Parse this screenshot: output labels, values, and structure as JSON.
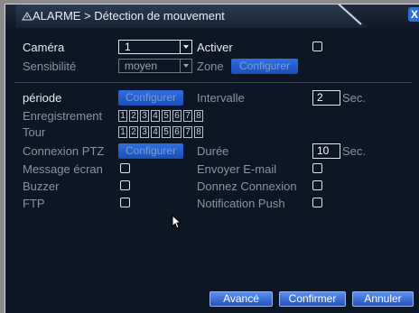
{
  "window": {
    "title": "ALARME > Détection de mouvement",
    "close_label": "X"
  },
  "form": {
    "camera_label": "Caméra",
    "camera_value": "1",
    "activate_label": "Activer",
    "sensitivity_label": "Sensibilité",
    "sensitivity_value": "moyen",
    "zone_label": "Zone",
    "zone_button": "Configurer",
    "period_label": "période",
    "period_button": "Configurer",
    "interval_label": "Intervalle",
    "interval_value": "2",
    "interval_unit": "Sec.",
    "recording_label": "Enregistrement",
    "recording_channels": [
      "1",
      "2",
      "3",
      "4",
      "5",
      "6",
      "7",
      "8"
    ],
    "tour_label": "Tour",
    "tour_channels": [
      "1",
      "2",
      "3",
      "4",
      "5",
      "6",
      "7",
      "8"
    ],
    "ptz_label": "Connexion PTZ",
    "ptz_button": "Configurer",
    "duration_label": "Durée",
    "duration_value": "10",
    "duration_unit": "Sec.",
    "screen_msg_label": "Message écran",
    "email_label": "Envoyer E-mail",
    "buzzer_label": "Buzzer",
    "connect_label": "Donnez Connexion",
    "ftp_label": "FTP",
    "push_label": "Notification Push"
  },
  "footer": {
    "advanced_label": "Avancé",
    "confirm_label": "Confirmer",
    "cancel_label": "Annuler"
  }
}
